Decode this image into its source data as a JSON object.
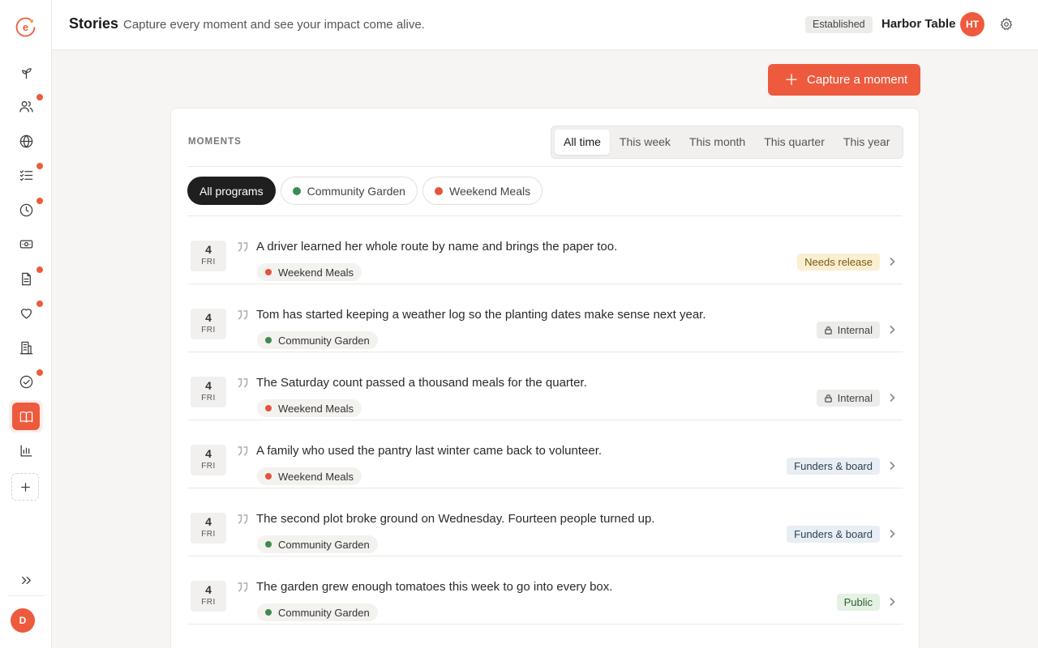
{
  "header": {
    "title": "Stories",
    "subtitle": "Capture every moment and see your impact come alive.",
    "stage_badge": "Established",
    "org_name": "Harbor Table",
    "org_initials": "HT"
  },
  "sidebar": {
    "user_initial": "D",
    "items": [
      {
        "icon": "sprout-icon",
        "alert": false
      },
      {
        "icon": "users-icon",
        "alert": true
      },
      {
        "icon": "globe-icon",
        "alert": false
      },
      {
        "icon": "checklist-icon",
        "alert": true
      },
      {
        "icon": "clock-icon",
        "alert": true
      },
      {
        "icon": "money-icon",
        "alert": false
      },
      {
        "icon": "document-icon",
        "alert": true
      },
      {
        "icon": "heart-icon",
        "alert": true
      },
      {
        "icon": "building-icon",
        "alert": false
      },
      {
        "icon": "check-circle-icon",
        "alert": true
      },
      {
        "icon": "book-open-icon",
        "alert": false,
        "active": true
      },
      {
        "icon": "bar-chart-icon",
        "alert": false
      }
    ]
  },
  "actions": {
    "capture_label": "Capture a moment"
  },
  "moments": {
    "section_label": "MOMENTS",
    "ranges": [
      "All time",
      "This week",
      "This month",
      "This quarter",
      "This year"
    ],
    "active_range": "All time",
    "filters": [
      {
        "label": "All programs",
        "color": null
      },
      {
        "label": "Community Garden",
        "color": "#3e8b4f"
      },
      {
        "label": "Weekend Meals",
        "color": "#e5533a"
      }
    ],
    "items": [
      {
        "day": "4",
        "dow": "FRI",
        "text": "A driver learned her whole route by name and brings the paper too.",
        "program": "Weekend Meals",
        "visibility": "Needs release"
      },
      {
        "day": "4",
        "dow": "FRI",
        "text": "Tom has started keeping a weather log so the planting dates make sense next year.",
        "program": "Community Garden",
        "visibility": "Internal"
      },
      {
        "day": "4",
        "dow": "FRI",
        "text": "The Saturday count passed a thousand meals for the quarter.",
        "program": "Weekend Meals",
        "visibility": "Internal"
      },
      {
        "day": "4",
        "dow": "FRI",
        "text": "A family who used the pantry last winter came back to volunteer.",
        "program": "Weekend Meals",
        "visibility": "Funders & board"
      },
      {
        "day": "4",
        "dow": "FRI",
        "text": "The second plot broke ground on Wednesday. Fourteen people turned up.",
        "program": "Community Garden",
        "visibility": "Funders & board"
      },
      {
        "day": "4",
        "dow": "FRI",
        "text": "The garden grew enough tomatoes this week to go into every box.",
        "program": "Community Garden",
        "visibility": "Public"
      }
    ]
  },
  "colors": {
    "accent": "#ee5a3d",
    "community_garden": "#3e8b4f",
    "weekend_meals": "#e5533a",
    "needs_release_bg": "#fbefd2",
    "needs_release_fg": "#7a5a12",
    "internal_bg": "#ececea",
    "internal_fg": "#444444",
    "funders_bg": "#e8eef3",
    "funders_fg": "#2e4253",
    "public_bg": "#e5f1e4",
    "public_fg": "#2f5e33"
  }
}
